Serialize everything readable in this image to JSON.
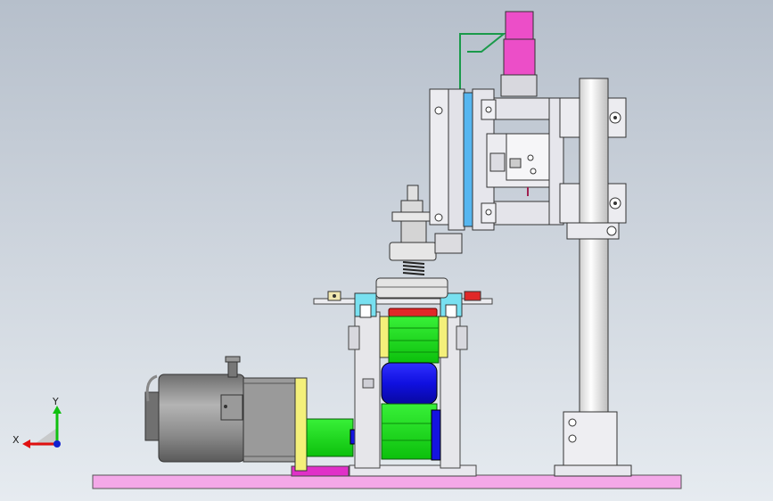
{
  "viewport": {
    "background_top": "#b6bfcb",
    "background_bottom": "#e6ebf0"
  },
  "triad": {
    "x_label": "X",
    "y_label": "Y"
  },
  "colors": {
    "base_plate": "#f4a8e8",
    "magenta": "#e030c8",
    "pink_block": "#ec4ec8",
    "green": "#19e619",
    "blue": "#1414e0",
    "yellow": "#f4f07a",
    "cyan": "#78e0f0",
    "red": "#e02828",
    "motor_body": "#8d8d8d",
    "light_blue_bar": "#56b6f0",
    "axis_red": "#e01010",
    "axis_green": "#10c010",
    "axis_blue": "#1020d0"
  }
}
